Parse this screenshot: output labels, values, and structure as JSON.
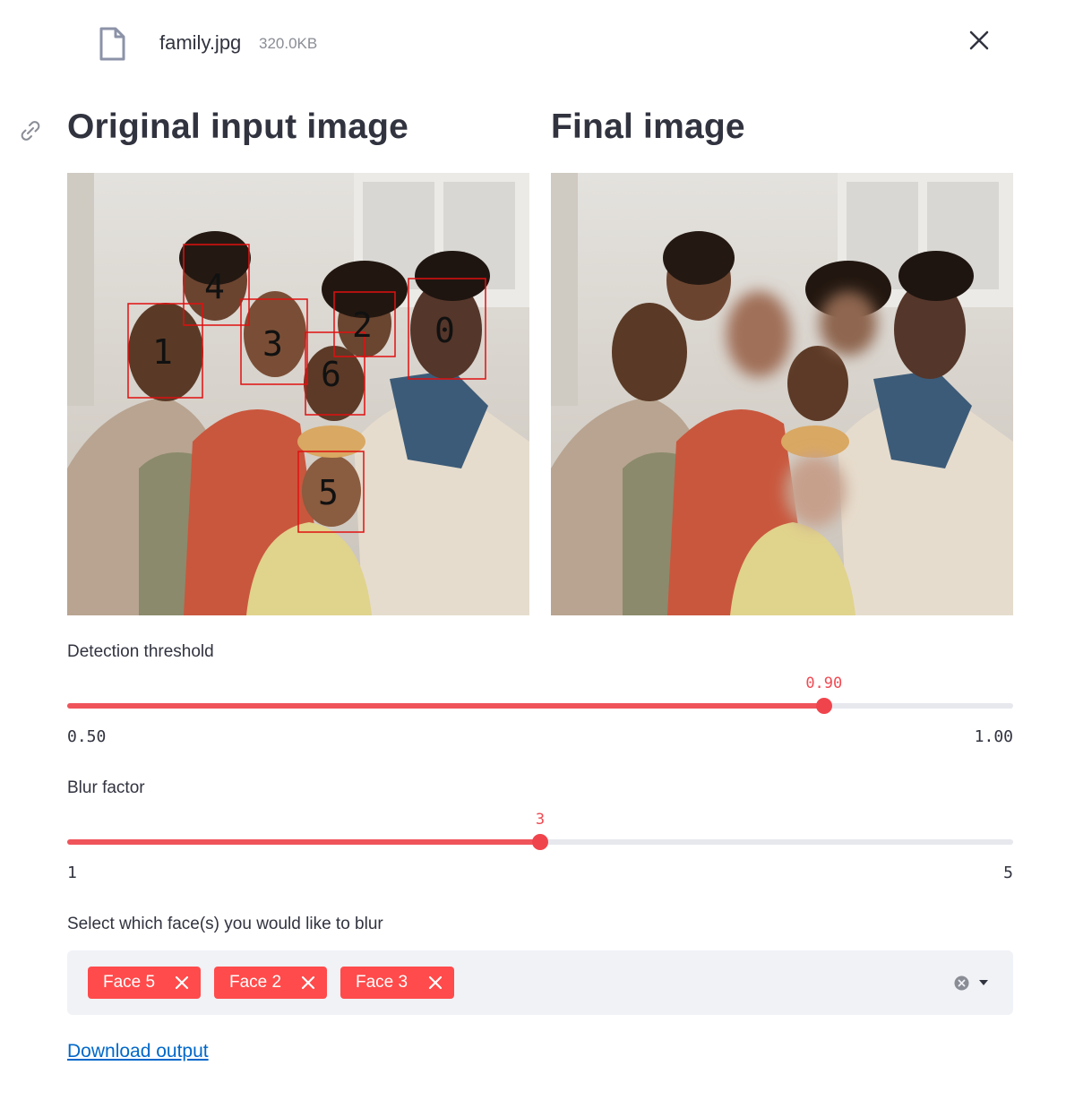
{
  "file": {
    "name": "family.jpg",
    "size": "320.0KB",
    "icon": "file-icon",
    "close_icon": "close-icon"
  },
  "headers": {
    "left": "Original input image",
    "right": "Final image",
    "anchor_icon": "link-icon"
  },
  "detection": {
    "face_labels": [
      "0",
      "1",
      "2",
      "3",
      "4",
      "5",
      "6"
    ],
    "box_color": "#e01010"
  },
  "threshold_slider": {
    "label": "Detection threshold",
    "value": "0.90",
    "min": "0.50",
    "max": "1.00",
    "fraction": 0.8
  },
  "blur_slider": {
    "label": "Blur factor",
    "value": "3",
    "min": "1",
    "max": "5",
    "fraction": 0.5
  },
  "face_select": {
    "label": "Select which face(s) you would like to blur",
    "selected": [
      "Face 5",
      "Face 2",
      "Face 3"
    ],
    "clear_icon": "clear-all-icon",
    "dropdown_icon": "chevron-down-icon"
  },
  "download": {
    "label": "Download output"
  },
  "colors": {
    "accent": "#ff4b4b",
    "link": "#0068c9",
    "text": "#31333f"
  }
}
